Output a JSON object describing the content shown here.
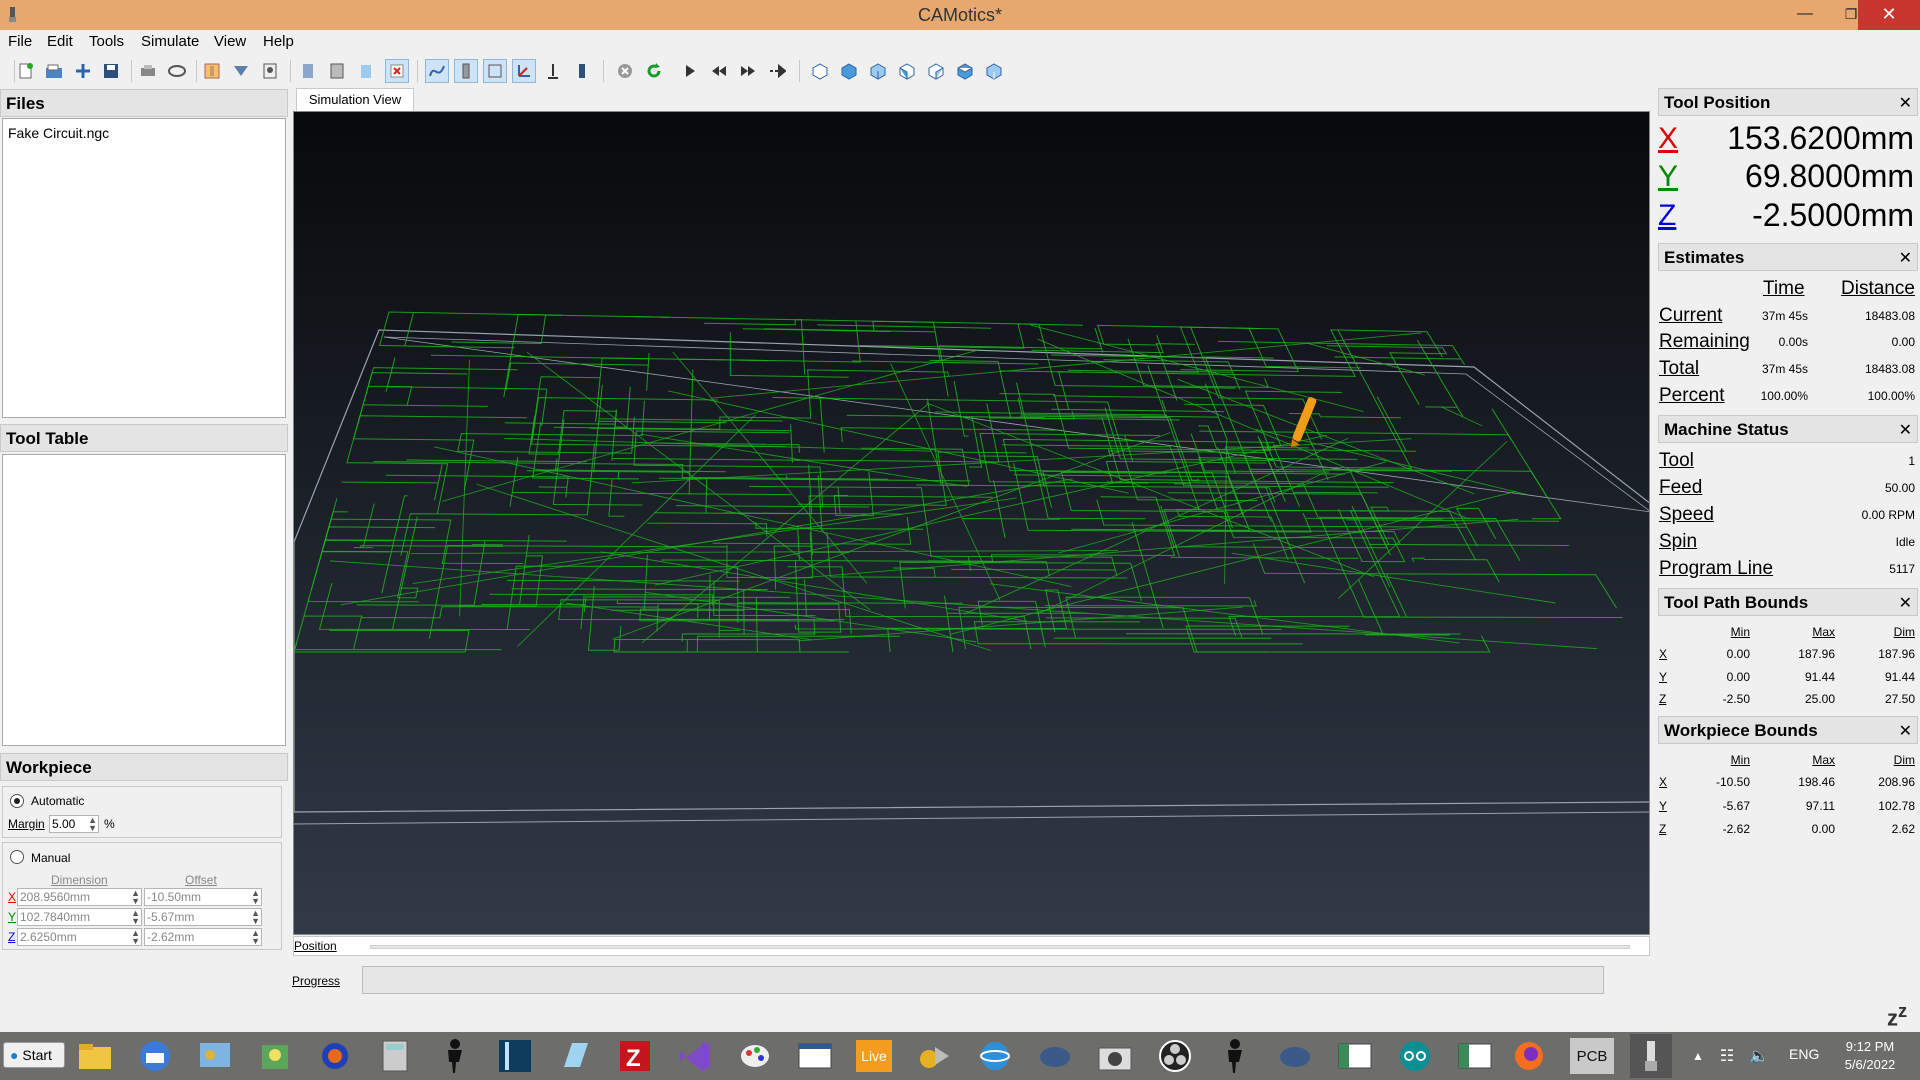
{
  "window": {
    "title": "CAMotics*"
  },
  "menu": [
    "File",
    "Edit",
    "Tools",
    "Simulate",
    "View",
    "Help"
  ],
  "panels": {
    "files": {
      "title": "Files",
      "items": [
        "Fake Circuit.ngc"
      ]
    },
    "tool_table": {
      "title": "Tool Table"
    },
    "workpiece": {
      "title": "Workpiece",
      "automatic_label": "Automatic",
      "margin_label": "Margin",
      "margin_value": "5.00",
      "margin_unit": "%",
      "manual_label": "Manual",
      "dimension_header": "Dimension",
      "offset_header": "Offset",
      "rows": [
        {
          "axis": "X",
          "dimension": "208.9560mm",
          "offset": "-10.50mm"
        },
        {
          "axis": "Y",
          "dimension": "102.7840mm",
          "offset": "-5.67mm"
        },
        {
          "axis": "Z",
          "dimension": "2.6250mm",
          "offset": "-2.62mm"
        }
      ]
    }
  },
  "center": {
    "tab_label": "Simulation View",
    "position_label": "Position",
    "progress_label": "Progress"
  },
  "tool_position": {
    "title": "Tool Position",
    "x": "153.6200mm",
    "y": "69.8000mm",
    "z": "-2.5000mm"
  },
  "estimates": {
    "title": "Estimates",
    "time_header": "Time",
    "distance_header": "Distance",
    "rows": [
      {
        "label": "Current",
        "time": "37m 45s",
        "distance": "18483.08"
      },
      {
        "label": "Remaining",
        "time": "0.00s",
        "distance": "0.00"
      },
      {
        "label": "Total",
        "time": "37m 45s",
        "distance": "18483.08"
      },
      {
        "label": "Percent",
        "time": "100.00%",
        "distance": "100.00%"
      }
    ]
  },
  "machine_status": {
    "title": "Machine Status",
    "rows": [
      {
        "label": "Tool",
        "value": "1"
      },
      {
        "label": "Feed",
        "value": "50.00"
      },
      {
        "label": "Speed",
        "value": "0.00 RPM"
      },
      {
        "label": "Spin",
        "value": "Idle"
      },
      {
        "label": "Program Line",
        "value": "5117"
      }
    ]
  },
  "tool_path_bounds": {
    "title": "Tool Path Bounds",
    "headers": [
      "Min",
      "Max",
      "Dim"
    ],
    "rows": [
      {
        "axis": "X",
        "min": "0.00",
        "max": "187.96",
        "dim": "187.96"
      },
      {
        "axis": "Y",
        "min": "0.00",
        "max": "91.44",
        "dim": "91.44"
      },
      {
        "axis": "Z",
        "min": "-2.50",
        "max": "25.00",
        "dim": "27.50"
      }
    ]
  },
  "workpiece_bounds": {
    "title": "Workpiece Bounds",
    "headers": [
      "Min",
      "Max",
      "Dim"
    ],
    "rows": [
      {
        "axis": "X",
        "min": "-10.50",
        "max": "198.46",
        "dim": "208.96"
      },
      {
        "axis": "Y",
        "min": "-5.67",
        "max": "97.11",
        "dim": "102.78"
      },
      {
        "axis": "Z",
        "min": "-2.62",
        "max": "0.00",
        "dim": "2.62"
      }
    ]
  },
  "colors": {
    "x_axis": "#e00000",
    "y_axis": "#008a00",
    "z_axis": "#0000e0",
    "toolpath": "#1fb31f",
    "tool": "#f29c1a"
  },
  "taskbar": {
    "start_label": "Start",
    "live_label": "Live",
    "pcb_label": "PCB",
    "lang": "ENG",
    "time": "9:12 PM",
    "date": "5/6/2022"
  }
}
